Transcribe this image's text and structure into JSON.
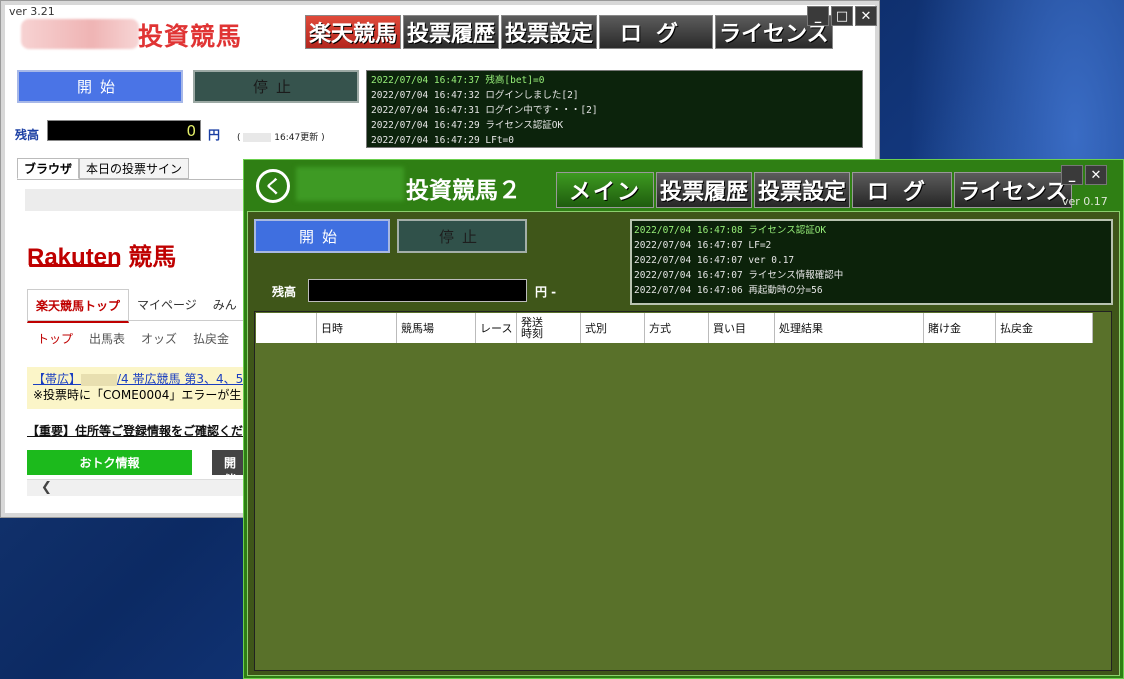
{
  "window1": {
    "version": "ver 3.21",
    "title": "投資競馬",
    "tabs": [
      "楽天競馬",
      "投票履歴",
      "投票設定",
      "ログ",
      "ライセンス"
    ],
    "controls": {
      "minimize": "_",
      "maximize": "□",
      "close": "✕"
    },
    "start_label": "開始",
    "stop_label": "停止",
    "log_lines": [
      "2022/07/04 16:47:37  残高[bet]=0",
      "2022/07/04 16:47:32  ログインしました[2]",
      "2022/07/04 16:47:31  ログイン中です・・・[2]",
      "2022/07/04 16:47:29  ライセンス認証OK",
      "2022/07/04 16:47:29  LFt=0"
    ],
    "balance_label": "残高",
    "balance_value": "0",
    "yen_label": "円",
    "update_prefix": "(",
    "update_text": "16:47更新 )",
    "browser_tabs": [
      "ブラウザ",
      "本日の投票サイン"
    ],
    "browser": {
      "logo": "Rakuten 競馬",
      "nav1": [
        "楽天競馬トップ",
        "マイページ",
        "みん"
      ],
      "nav2": [
        "トップ",
        "出馬表",
        "オッズ",
        "払戻金"
      ],
      "notice_link_prefix": "【帯広】",
      "notice_link_suffix": "/4  帯広競馬 第3、4、5",
      "notice_text": "※投票時に「COME0004」エラーが生じ",
      "important": "【重要】住所等ご登録情報をご確認くだ",
      "green_button": "おトク情報",
      "dark_button": "開催"
    }
  },
  "window2": {
    "logo": "く",
    "title": "投資競馬２",
    "tabs": [
      "メイン",
      "投票履歴",
      "投票設定",
      "ログ",
      "ライセンス"
    ],
    "version": "ver 0.17",
    "start_label": "開始",
    "stop_label": "停止",
    "log_lines": [
      "2022/07/04 16:47:08  ライセンス認証OK",
      "2022/07/04 16:47:07  LF=2",
      "2022/07/04 16:47:07  ver 0.17",
      "2022/07/04 16:47:07  ライセンス情報確認中",
      "2022/07/04 16:47:06  再起動時の分=56"
    ],
    "balance_label": "残高",
    "yen_label": "円 -",
    "grid_columns": [
      "",
      "日時",
      "競馬場",
      "レース",
      "発送\n時刻",
      "式別",
      "方式",
      "買い目",
      "処理結果",
      "賭け金",
      "払戻金"
    ]
  }
}
